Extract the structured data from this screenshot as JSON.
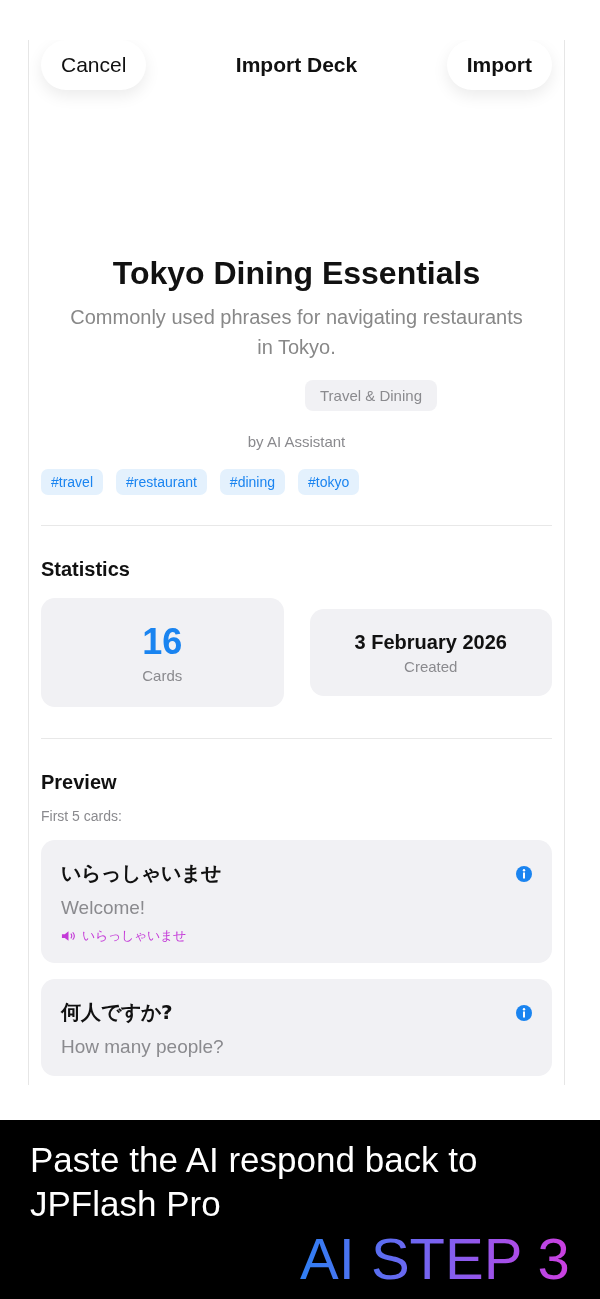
{
  "nav": {
    "cancel": "Cancel",
    "title": "Import Deck",
    "import": "Import"
  },
  "deck": {
    "title": "Tokyo Dining Essentials",
    "description": "Commonly used phrases for navigating restaurants in Tokyo.",
    "category": "Travel & Dining",
    "author": "by AI Assistant",
    "tags": [
      "#travel",
      "#restaurant",
      "#dining",
      "#tokyo"
    ]
  },
  "statistics": {
    "heading": "Statistics",
    "cards": {
      "value": "16",
      "label": "Cards"
    },
    "created": {
      "value": "3 February 2026",
      "label": "Created"
    }
  },
  "preview": {
    "heading": "Preview",
    "subheading": "First 5 cards:",
    "cards": [
      {
        "front": "いらっしゃいませ",
        "back": "Welcome!",
        "reading": "いらっしゃいませ"
      },
      {
        "front": "何人ですか?",
        "back": "How many people?"
      }
    ]
  },
  "caption": {
    "text": "Paste the AI respond back to JPFlash Pro",
    "step": "AI STEP 3"
  }
}
